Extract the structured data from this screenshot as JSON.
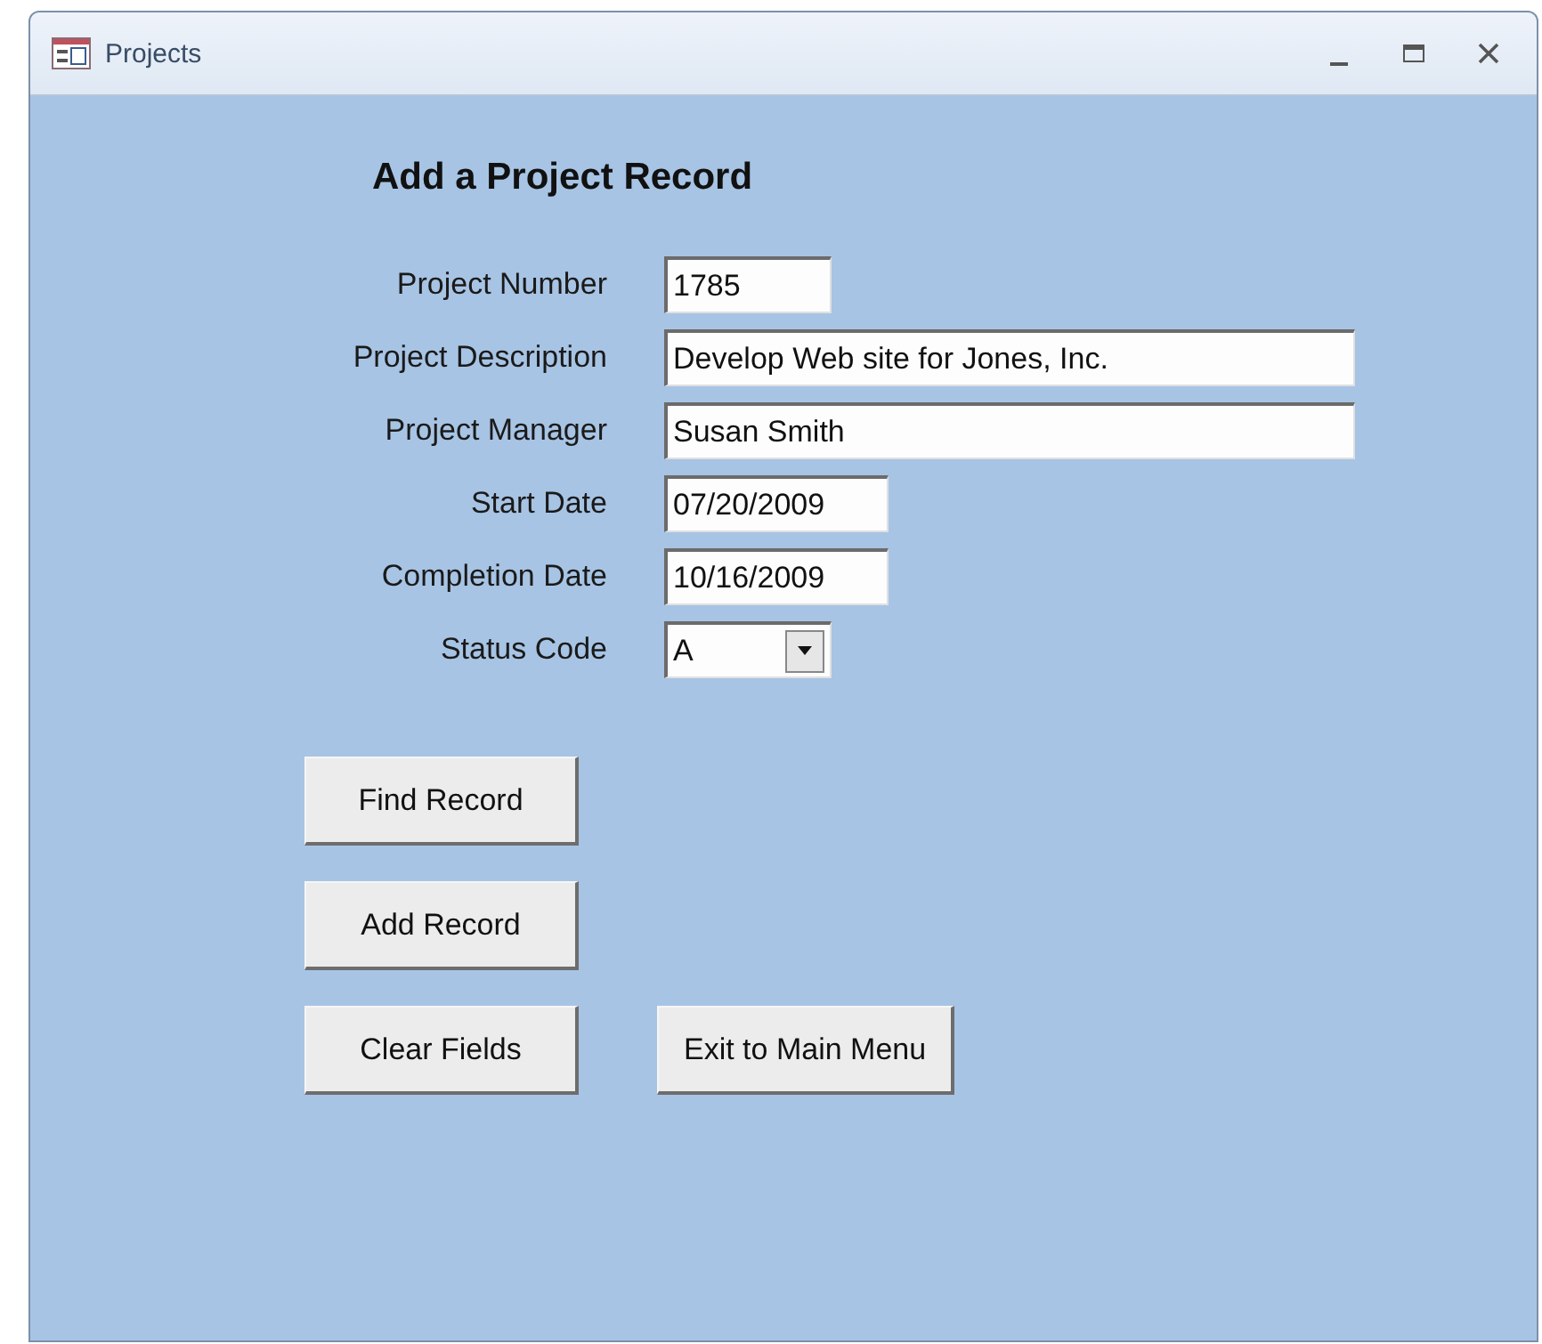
{
  "window": {
    "title": "Projects"
  },
  "form": {
    "heading": "Add a Project Record",
    "fields": [
      {
        "label": "Project Number",
        "value": "1785",
        "kind": "text"
      },
      {
        "label": "Project Description",
        "value": "Develop Web site for Jones, Inc.",
        "kind": "text"
      },
      {
        "label": "Project Manager",
        "value": "Susan Smith",
        "kind": "text"
      },
      {
        "label": "Start Date",
        "value": "07/20/2009",
        "kind": "text"
      },
      {
        "label": "Completion Date",
        "value": "10/16/2009",
        "kind": "text"
      },
      {
        "label": "Status Code",
        "value": "A",
        "kind": "combo"
      }
    ],
    "button_rows": [
      [
        "Find Record"
      ],
      [
        "Add Record"
      ],
      [
        "Clear Fields",
        "Exit to Main Menu"
      ]
    ]
  }
}
